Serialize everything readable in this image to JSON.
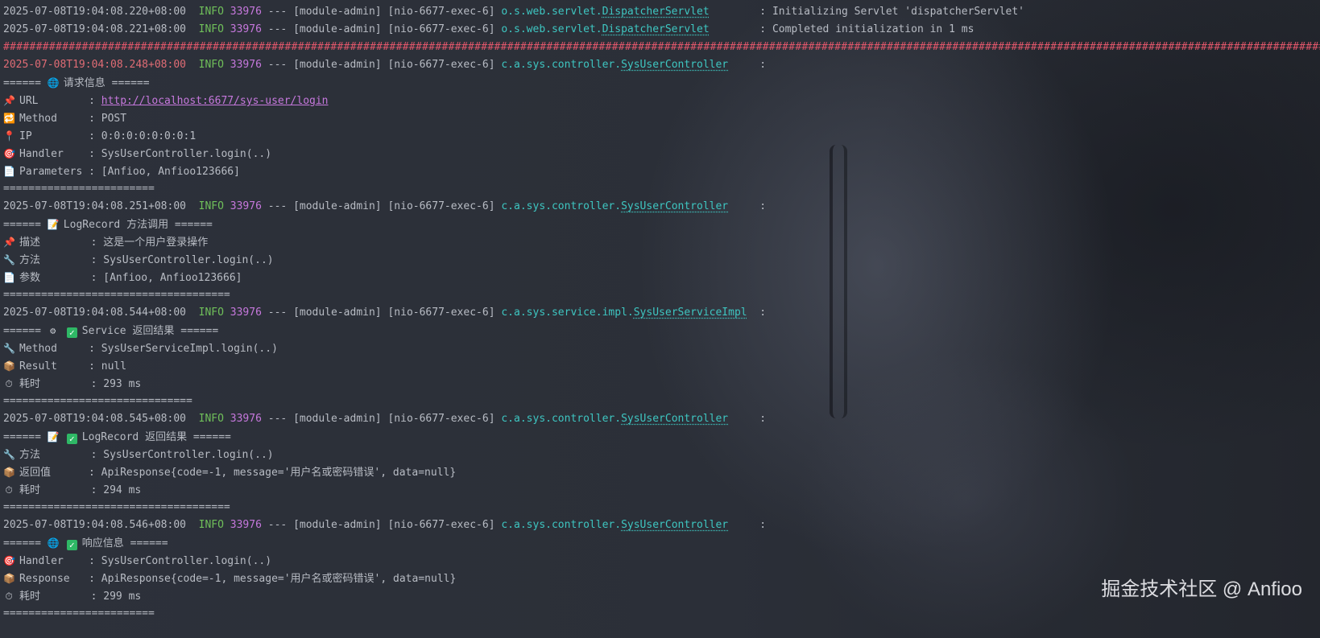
{
  "lines": [
    {
      "ts": "2025-07-08T19:04:08.220+08:00",
      "level": "INFO",
      "pid": "33976",
      "sep": "---",
      "module": "[module-admin]",
      "thread": "[nio-6677-exec-6]",
      "pkg": "o.s.web.servlet.",
      "cls": "DispatcherServlet",
      "pad": "        : ",
      "msg": "Initializing Servlet 'dispatcherServlet'"
    },
    {
      "ts": "2025-07-08T19:04:08.221+08:00",
      "level": "INFO",
      "pid": "33976",
      "sep": "---",
      "module": "[module-admin]",
      "thread": "[nio-6677-exec-6]",
      "pkg": "o.s.web.servlet.",
      "cls": "DispatcherServlet",
      "pad": "        : ",
      "msg": "Completed initialization in 1 ms"
    },
    {
      "hash": "################################################################################################################################################################################################################"
    },
    {
      "ts": "2025-07-08T19:04:08.248+08:00",
      "level": "INFO",
      "pid": "33976",
      "sep": "---",
      "module": "[module-admin]",
      "thread": "[nio-6677-exec-6]",
      "pkg": "c.a.sys.controller.",
      "cls": "SysUserController",
      "pad": "     :",
      "msg": ""
    },
    {
      "header": "====== ",
      "icon": "globe-icon",
      "glyph": "🌐",
      "title": "请求信息 ======"
    },
    {
      "icon": "pin-icon",
      "glyph": "📌",
      "key": "URL        : ",
      "url": "http://localhost:6677/sys-user/login"
    },
    {
      "icon": "method-icon",
      "glyph": "🔁",
      "key": "Method     : ",
      "val": "POST"
    },
    {
      "icon": "location-icon",
      "glyph": "📍",
      "key": "IP         : ",
      "val": "0:0:0:0:0:0:0:1"
    },
    {
      "icon": "target-icon",
      "glyph": "🎯",
      "key": "Handler    : ",
      "val": "SysUserController.login(..)"
    },
    {
      "icon": "document-icon",
      "glyph": "📄",
      "key": "Parameters : ",
      "val": "[Anfioo, Anfioo123666]"
    },
    {
      "plain": "========================"
    },
    {
      "ts": "2025-07-08T19:04:08.251+08:00",
      "level": "INFO",
      "pid": "33976",
      "sep": "---",
      "module": "[module-admin]",
      "thread": "[nio-6677-exec-6]",
      "pkg": "c.a.sys.controller.",
      "cls": "SysUserController",
      "pad": "     :",
      "msg": ""
    },
    {
      "header": "====== ",
      "icon": "memo-icon",
      "glyph": "📝",
      "title": "LogRecord 方法调用 ======"
    },
    {
      "icon": "pin-icon",
      "glyph": "📌",
      "key": "描述        : ",
      "val": "这是一个用户登录操作"
    },
    {
      "icon": "wrench-icon",
      "glyph": "🔧",
      "key": "方法        : ",
      "val": "SysUserController.login(..)"
    },
    {
      "icon": "document-icon",
      "glyph": "📄",
      "key": "参数        : ",
      "val": "[Anfioo, Anfioo123666]"
    },
    {
      "plain": "===================================="
    },
    {
      "ts": "2025-07-08T19:04:08.544+08:00",
      "level": "INFO",
      "pid": "33976",
      "sep": "---",
      "module": "[module-admin]",
      "thread": "[nio-6677-exec-6]",
      "pkg": "c.a.sys.service.impl.",
      "cls": "SysUserServiceImpl",
      "pad": "  :",
      "msg": ""
    },
    {
      "header": "====== ",
      "icon": "gear-icon",
      "glyph": "⚙",
      "check": true,
      "title": "Service 返回结果 ======"
    },
    {
      "icon": "wrench-icon",
      "glyph": "🔧",
      "key": "Method     : ",
      "val": "SysUserServiceImpl.login(..)"
    },
    {
      "icon": "inbox-icon",
      "glyph": "📦",
      "key": "Result     : ",
      "val": "null"
    },
    {
      "icon": "stopwatch-icon",
      "glyph": "⏱",
      "key": "耗时        : ",
      "val": "293 ms"
    },
    {
      "plain": "=============================="
    },
    {
      "ts": "2025-07-08T19:04:08.545+08:00",
      "level": "INFO",
      "pid": "33976",
      "sep": "---",
      "module": "[module-admin]",
      "thread": "[nio-6677-exec-6]",
      "pkg": "c.a.sys.controller.",
      "cls": "SysUserController",
      "pad": "     :",
      "msg": ""
    },
    {
      "header": "====== ",
      "icon": "memo-icon",
      "glyph": "📝",
      "check": true,
      "title": "LogRecord 返回结果 ======"
    },
    {
      "icon": "wrench-icon",
      "glyph": "🔧",
      "key": "方法        : ",
      "val": "SysUserController.login(..)"
    },
    {
      "icon": "inbox-icon",
      "glyph": "📦",
      "key": "返回值      : ",
      "val": "ApiResponse{code=-1, message='用户名或密码错误', data=null}"
    },
    {
      "icon": "stopwatch-icon",
      "glyph": "⏱",
      "key": "耗时        : ",
      "val": "294 ms"
    },
    {
      "plain": "===================================="
    },
    {
      "ts": "2025-07-08T19:04:08.546+08:00",
      "level": "INFO",
      "pid": "33976",
      "sep": "---",
      "module": "[module-admin]",
      "thread": "[nio-6677-exec-6]",
      "pkg": "c.a.sys.controller.",
      "cls": "SysUserController",
      "pad": "     :",
      "msg": ""
    },
    {
      "header": "====== ",
      "icon": "globe-icon",
      "glyph": "🌐",
      "check": true,
      "title": "响应信息 ======"
    },
    {
      "icon": "target-icon",
      "glyph": "🎯",
      "key": "Handler    : ",
      "val": "SysUserController.login(..)"
    },
    {
      "icon": "inbox-icon",
      "glyph": "📦",
      "key": "Response   : ",
      "val": "ApiResponse{code=-1, message='用户名或密码错误', data=null}"
    },
    {
      "icon": "stopwatch-icon",
      "glyph": "⏱",
      "key": "耗时        : ",
      "val": "299 ms"
    },
    {
      "plain": "========================"
    }
  ],
  "check_glyph": "✓",
  "watermark": "掘金技术社区 @ Anfioo"
}
